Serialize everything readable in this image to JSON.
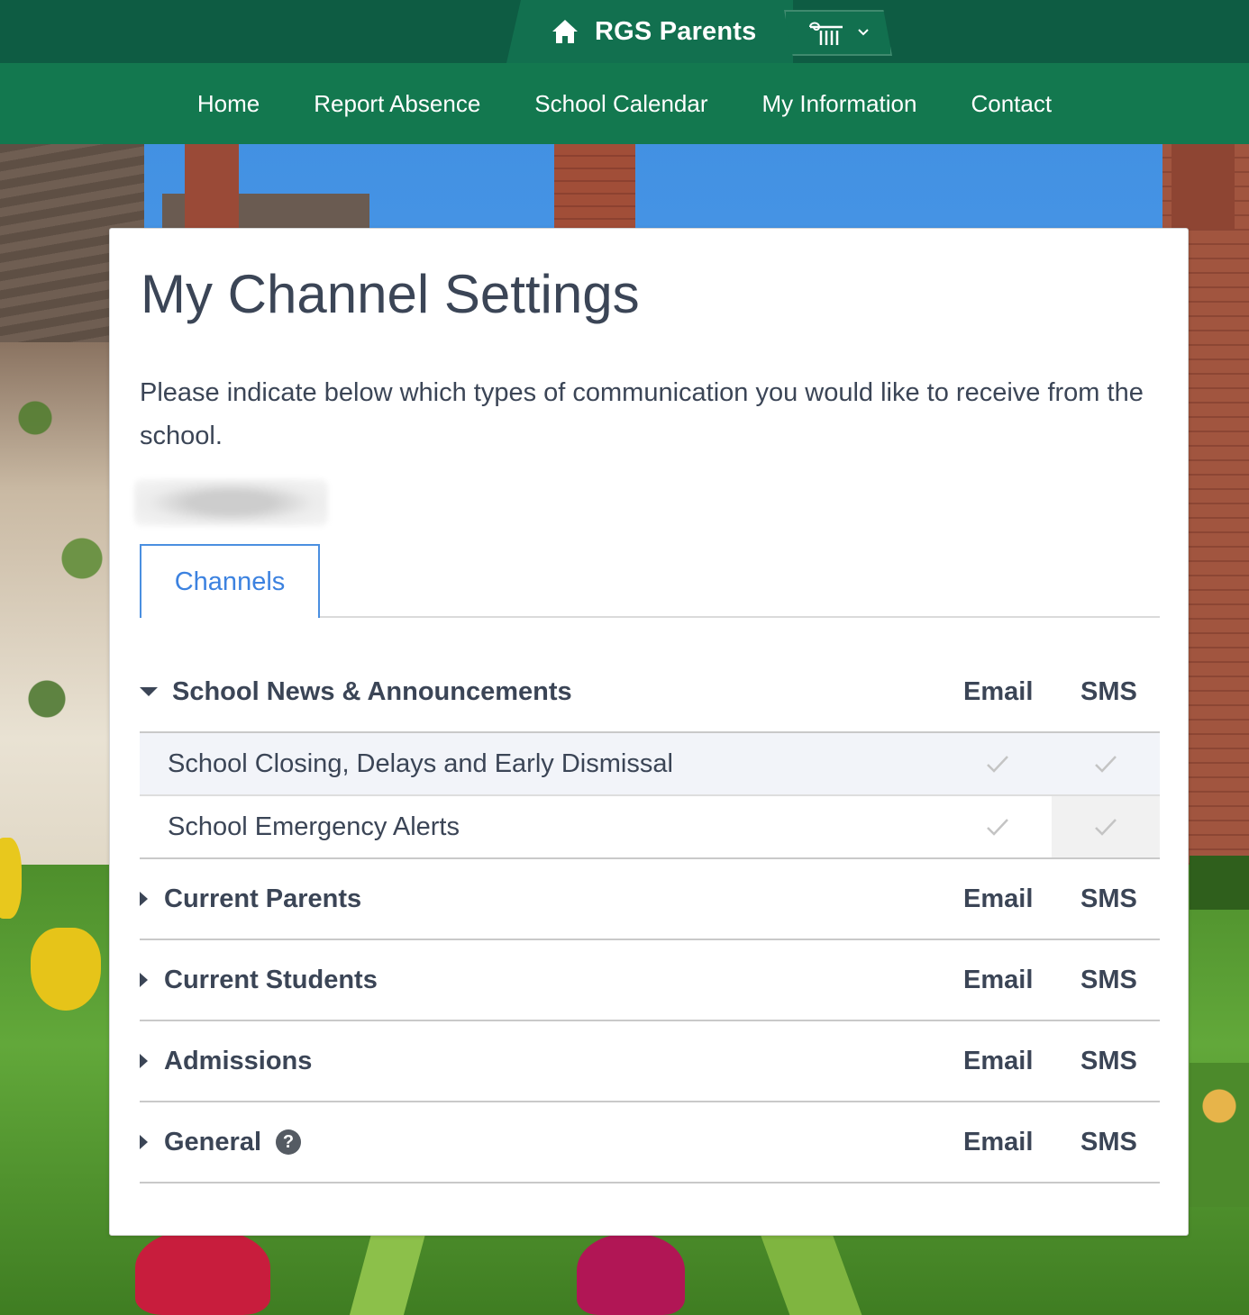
{
  "header": {
    "brand_title": "RGS Parents",
    "home_icon": "home-icon",
    "switcher_icon": "school-logo-icon"
  },
  "nav": {
    "items": [
      {
        "label": "Home"
      },
      {
        "label": "Report Absence"
      },
      {
        "label": "School Calendar"
      },
      {
        "label": "My Information"
      },
      {
        "label": "Contact"
      }
    ]
  },
  "page": {
    "title": "My Channel Settings",
    "intro": "Please indicate below which types of communication you would like to receive from the school.",
    "tab_label": "Channels"
  },
  "columns": {
    "email": "Email",
    "sms": "SMS"
  },
  "groups": [
    {
      "name": "School News & Announcements",
      "expanded": true,
      "items": [
        {
          "label": "School Closing, Delays and Early Dismissal",
          "email": true,
          "sms": true
        },
        {
          "label": "School Emergency Alerts",
          "email": true,
          "sms": true
        }
      ]
    },
    {
      "name": "Current Parents",
      "expanded": false
    },
    {
      "name": "Current Students",
      "expanded": false
    },
    {
      "name": "Admissions",
      "expanded": false
    },
    {
      "name": "General",
      "expanded": false,
      "help_icon": "?"
    }
  ],
  "colors": {
    "topbar": "#0e5c43",
    "navbar": "#13784f",
    "tab_accent": "#3c82e0",
    "text": "#3b4556"
  }
}
